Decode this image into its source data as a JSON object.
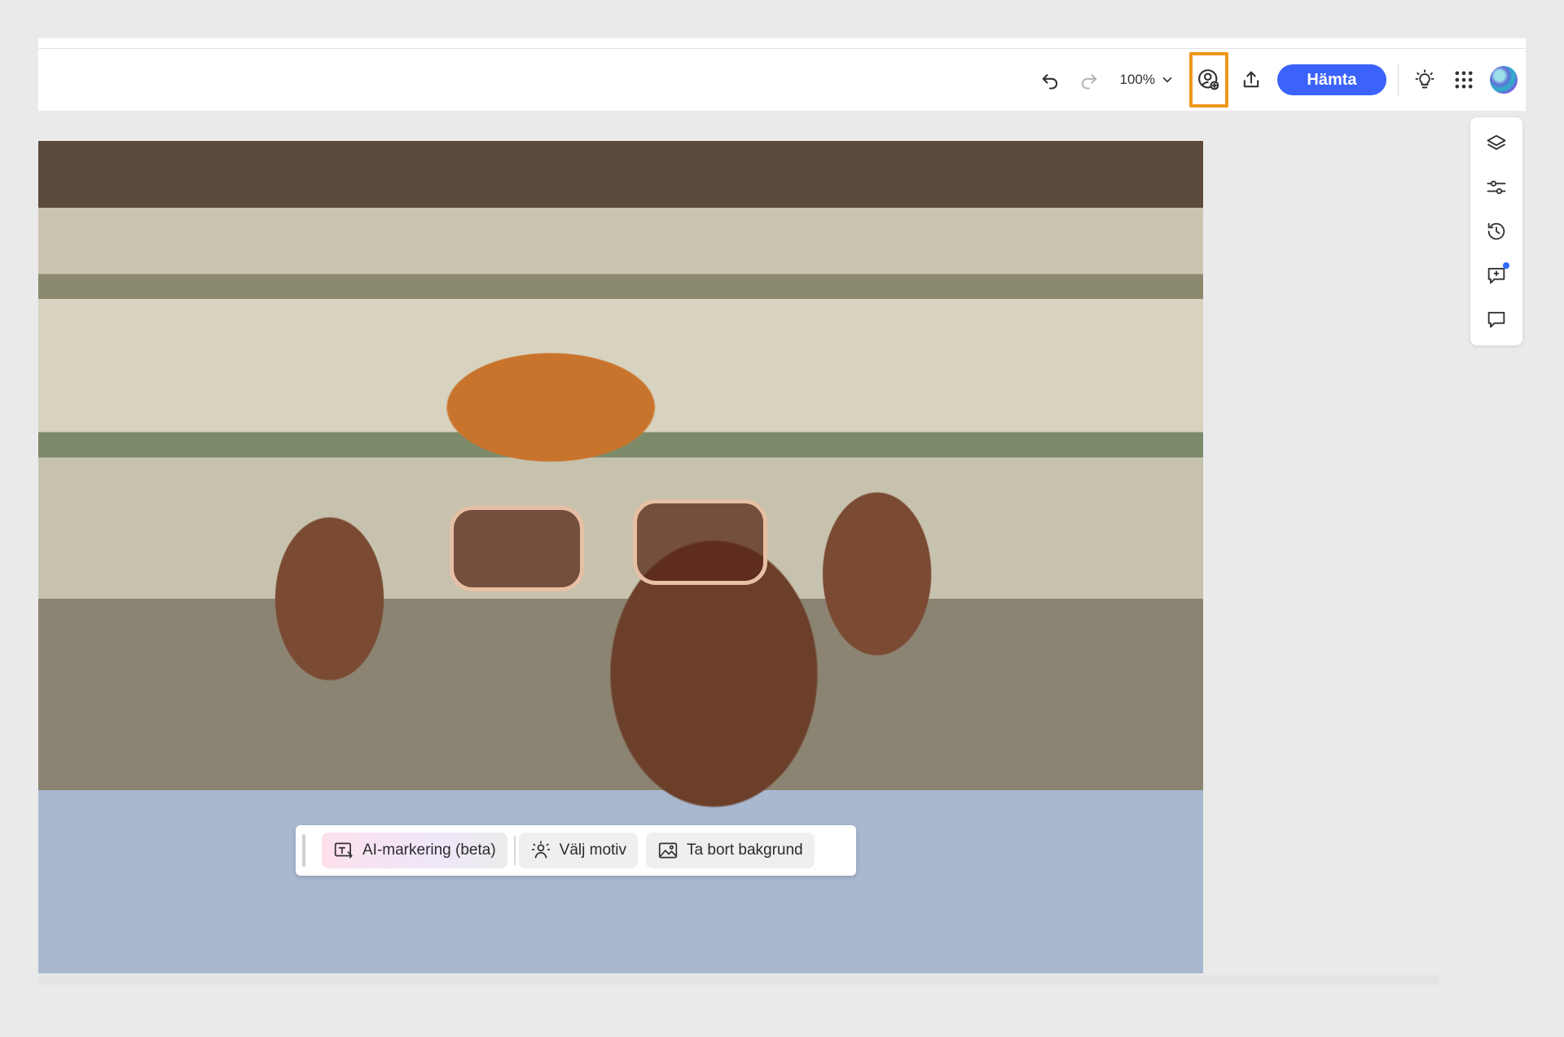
{
  "toolbar": {
    "zoom_value": "100%",
    "download_label": "Hämta"
  },
  "selection_bar": {
    "ai_select_label": "AI-markering (beta)",
    "select_subject_label": "Välj motiv",
    "remove_background_label": "Ta bort bakgrund"
  },
  "colors": {
    "accent": "#3b63fb",
    "highlight": "#f0961c"
  },
  "icons": {
    "toolbar": [
      "undo-icon",
      "redo-icon",
      "chevron-down-icon",
      "user-add-icon",
      "share-upload-icon",
      "lightbulb-icon",
      "app-grid-icon",
      "avatar"
    ],
    "side_panel": [
      "layers-icon",
      "adjustments-icon",
      "history-icon",
      "feedback-icon",
      "comment-icon"
    ]
  }
}
